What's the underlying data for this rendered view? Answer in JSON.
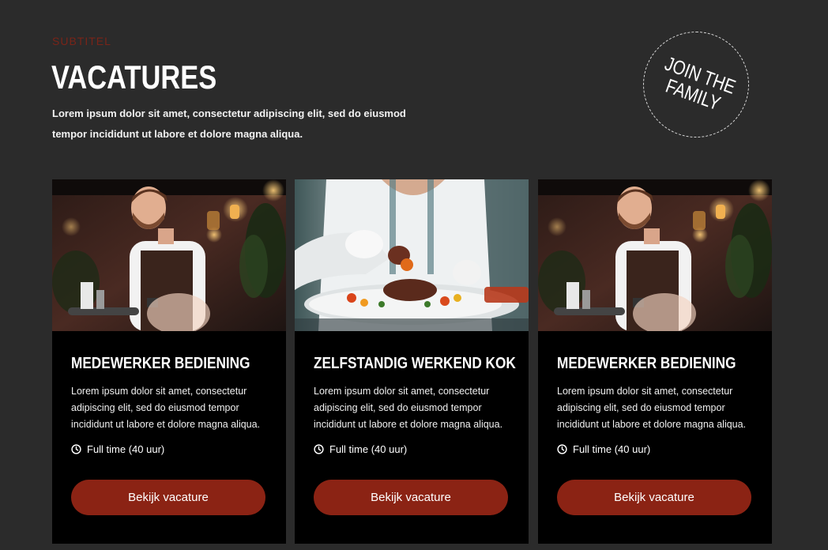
{
  "header": {
    "subtitle": "SUBTITEL",
    "title": "VACATURES",
    "intro": "Lorem ipsum dolor sit amet, consectetur adipiscing elit, sed do eiusmod tempor incididunt ut labore et dolore magna aliqua."
  },
  "badge": {
    "line1": "JOIN THE",
    "line2": "FAMILY"
  },
  "cards": [
    {
      "image": "waiter-photo",
      "title": "MEDEWERKER BEDIENING",
      "description": "Lorem ipsum dolor sit amet, consectetur adipiscing elit, sed do eiusmod tempor incididunt ut labore et dolore magna aliqua.",
      "hours": "Full time (40 uur)",
      "button": "Bekijk vacature"
    },
    {
      "image": "chef-plating-photo",
      "title": "ZELFSTANDIG WERKEND KOK",
      "description": "Lorem ipsum dolor sit amet, consectetur adipiscing elit, sed do eiusmod tempor incididunt ut labore et dolore magna aliqua.",
      "hours": "Full time (40 uur)",
      "button": "Bekijk vacature"
    },
    {
      "image": "waiter-photo",
      "title": "MEDEWERKER BEDIENING",
      "description": "Lorem ipsum dolor sit amet, consectetur adipiscing elit, sed do eiusmod tempor incididunt ut labore et dolore magna aliqua.",
      "hours": "Full time (40 uur)",
      "button": "Bekijk vacature"
    }
  ],
  "colors": {
    "background": "#2b2b2b",
    "card": "#000000",
    "accent": "#8b2314",
    "subtitle": "#7a2418"
  },
  "icons": {
    "meta": "clock-icon"
  }
}
